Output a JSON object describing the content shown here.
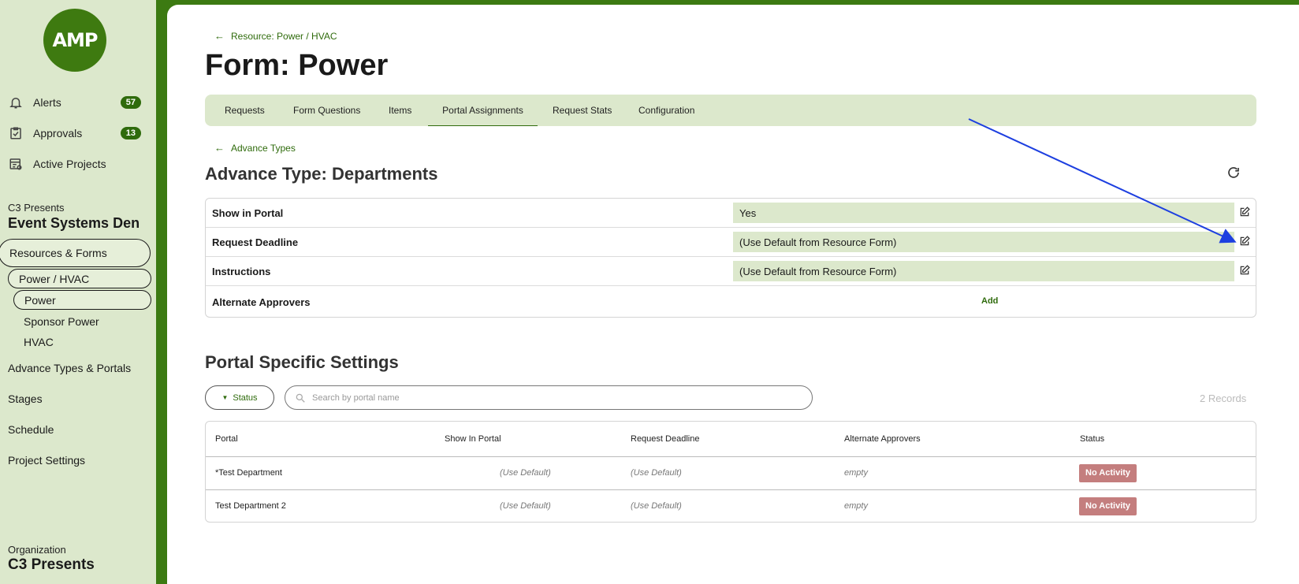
{
  "sidebar": {
    "logo_text": "AMP",
    "top_items": [
      {
        "label": "Alerts",
        "badge": "57",
        "icon": "bell-icon"
      },
      {
        "label": "Approvals",
        "badge": "13",
        "icon": "clipboard-check-icon"
      },
      {
        "label": "Active Projects",
        "icon": "calendar-list-icon"
      }
    ],
    "company_label": "C3 Presents",
    "project_name": "Event Systems Den",
    "nav": {
      "resources_forms": "Resources & Forms",
      "power_hvac": "Power / HVAC",
      "power": "Power",
      "sponsor_power": "Sponsor Power",
      "hvac": "HVAC",
      "advance_types": "Advance Types & Portals",
      "stages": "Stages",
      "schedule": "Schedule",
      "project_settings": "Project Settings"
    },
    "org_label": "Organization",
    "org_name": "C3 Presents"
  },
  "main": {
    "breadcrumb": "Resource: Power / HVAC",
    "title": "Form: Power",
    "tabs": [
      {
        "label": "Requests"
      },
      {
        "label": "Form Questions"
      },
      {
        "label": "Items"
      },
      {
        "label": "Portal Assignments",
        "active": true
      },
      {
        "label": "Request Stats"
      },
      {
        "label": "Configuration"
      }
    ],
    "back_link": "Advance Types",
    "advance_title": "Advance Type: Departments",
    "settings": [
      {
        "label": "Show in Portal",
        "value": "Yes"
      },
      {
        "label": "Request Deadline",
        "value": "(Use Default from Resource Form)"
      },
      {
        "label": "Instructions",
        "value": "(Use Default from Resource Form)"
      },
      {
        "label": "Alternate Approvers",
        "action": "Add"
      }
    ],
    "portal_title": "Portal Specific Settings",
    "filter_status": "Status",
    "search_placeholder": "Search by portal name",
    "records": "2 Records",
    "table": {
      "headers": [
        "Portal",
        "Show In Portal",
        "Request Deadline",
        "Alternate Approvers",
        "Status"
      ],
      "rows": [
        [
          "*Test Department",
          "(Use Default)",
          "(Use Default)",
          "empty",
          "No Activity"
        ],
        [
          "Test Department 2",
          "(Use Default)",
          "(Use Default)",
          "empty",
          "No Activity"
        ]
      ]
    }
  },
  "colors": {
    "brand": "#3c7a12",
    "sidebar_bg": "#dce8cc",
    "badge_red": "#c47e7e",
    "annotation_arrow": "#1d3fe0"
  }
}
